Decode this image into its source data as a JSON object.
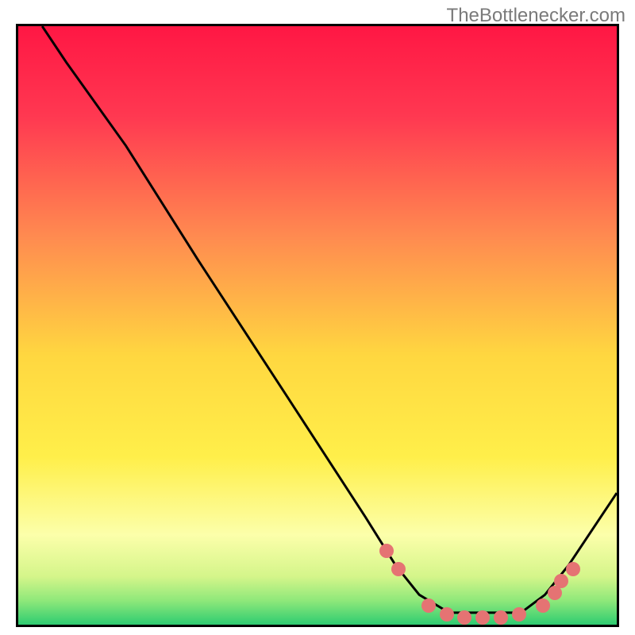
{
  "attribution": "TheBottlenecker.com",
  "chart_data": {
    "type": "line",
    "title": "",
    "xlabel": "",
    "ylabel": "",
    "x_range": [
      0,
      100
    ],
    "y_range": [
      0,
      100
    ],
    "curve_points": [
      {
        "x": 4,
        "y": 100
      },
      {
        "x": 8,
        "y": 94
      },
      {
        "x": 18,
        "y": 80
      },
      {
        "x": 30,
        "y": 61
      },
      {
        "x": 45,
        "y": 38
      },
      {
        "x": 58,
        "y": 18
      },
      {
        "x": 63,
        "y": 10
      },
      {
        "x": 67,
        "y": 5
      },
      {
        "x": 72,
        "y": 2
      },
      {
        "x": 78,
        "y": 2
      },
      {
        "x": 84,
        "y": 2
      },
      {
        "x": 88,
        "y": 5
      },
      {
        "x": 92,
        "y": 10
      },
      {
        "x": 100,
        "y": 22
      }
    ],
    "markers": [
      {
        "x": 61,
        "y": 13
      },
      {
        "x": 63,
        "y": 10
      },
      {
        "x": 68,
        "y": 4
      },
      {
        "x": 71,
        "y": 2.5
      },
      {
        "x": 74,
        "y": 2
      },
      {
        "x": 77,
        "y": 2
      },
      {
        "x": 80,
        "y": 2
      },
      {
        "x": 83,
        "y": 2.5
      },
      {
        "x": 87,
        "y": 4
      },
      {
        "x": 89,
        "y": 6
      },
      {
        "x": 90,
        "y": 8
      },
      {
        "x": 92,
        "y": 10
      }
    ],
    "gradient_stops": [
      {
        "offset": 0,
        "color": "#ff1744"
      },
      {
        "offset": 0.15,
        "color": "#ff3851"
      },
      {
        "offset": 0.35,
        "color": "#ff8a50"
      },
      {
        "offset": 0.55,
        "color": "#ffd740"
      },
      {
        "offset": 0.72,
        "color": "#ffef4a"
      },
      {
        "offset": 0.85,
        "color": "#fcffaa"
      },
      {
        "offset": 0.92,
        "color": "#d4f58a"
      },
      {
        "offset": 0.96,
        "color": "#8ee87a"
      },
      {
        "offset": 1.0,
        "color": "#2ecc71"
      }
    ]
  }
}
